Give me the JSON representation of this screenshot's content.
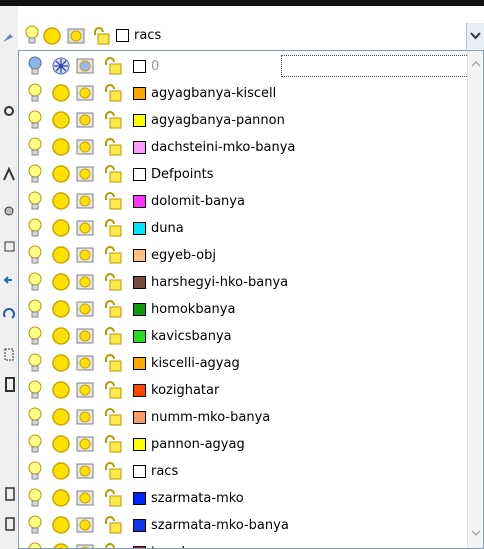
{
  "combo": {
    "selected_label": "racs",
    "swatch_color": "#ffffff"
  },
  "layers": [
    {
      "name": "0",
      "color": "#ffffff",
      "on": true,
      "frozen": true,
      "current": true
    },
    {
      "name": "agyagbanya-kiscell",
      "color": "#ffa500",
      "on": true,
      "frozen": false,
      "current": false
    },
    {
      "name": "agyagbanya-pannon",
      "color": "#ffff00",
      "on": true,
      "frozen": false,
      "current": false
    },
    {
      "name": "dachsteini-mko-banya",
      "color": "#ff99ff",
      "on": true,
      "frozen": false,
      "current": false
    },
    {
      "name": "Defpoints",
      "color": "#ffffff",
      "on": true,
      "frozen": false,
      "current": false
    },
    {
      "name": "dolomit-banya",
      "color": "#ff33ff",
      "on": true,
      "frozen": false,
      "current": false
    },
    {
      "name": "duna",
      "color": "#00e5ff",
      "on": true,
      "frozen": false,
      "current": false
    },
    {
      "name": "egyeb-obj",
      "color": "#ffbf80",
      "on": true,
      "frozen": false,
      "current": false
    },
    {
      "name": "harshegyi-hko-banya",
      "color": "#7a4a3a",
      "on": true,
      "frozen": false,
      "current": false
    },
    {
      "name": "homokbanya",
      "color": "#119911",
      "on": true,
      "frozen": false,
      "current": false
    },
    {
      "name": "kavicsbanya",
      "color": "#22dd22",
      "on": true,
      "frozen": false,
      "current": false
    },
    {
      "name": "kiscelli-agyag",
      "color": "#ffaa00",
      "on": true,
      "frozen": false,
      "current": false
    },
    {
      "name": "kozighatar",
      "color": "#ff4400",
      "on": true,
      "frozen": false,
      "current": false
    },
    {
      "name": "numm-mko-banya",
      "color": "#ff9966",
      "on": true,
      "frozen": false,
      "current": false
    },
    {
      "name": "pannon-agyag",
      "color": "#ffff00",
      "on": true,
      "frozen": false,
      "current": false
    },
    {
      "name": "racs",
      "color": "#ffffff",
      "on": true,
      "frozen": false,
      "current": false
    },
    {
      "name": "szarmata-mko",
      "color": "#0022ff",
      "on": true,
      "frozen": false,
      "current": false
    },
    {
      "name": "szarmata-mko-banya",
      "color": "#1133ee",
      "on": true,
      "frozen": false,
      "current": false
    },
    {
      "name": "trav-banya",
      "color": "#aa2222",
      "on": true,
      "frozen": false,
      "current": false
    }
  ],
  "icons": {
    "on": "lightbulb-icon",
    "thaw": "sun-icon",
    "vp_freeze": "viewport-sun-icon",
    "lock": "padlock-icon",
    "frozen": "snowflake-icon"
  }
}
